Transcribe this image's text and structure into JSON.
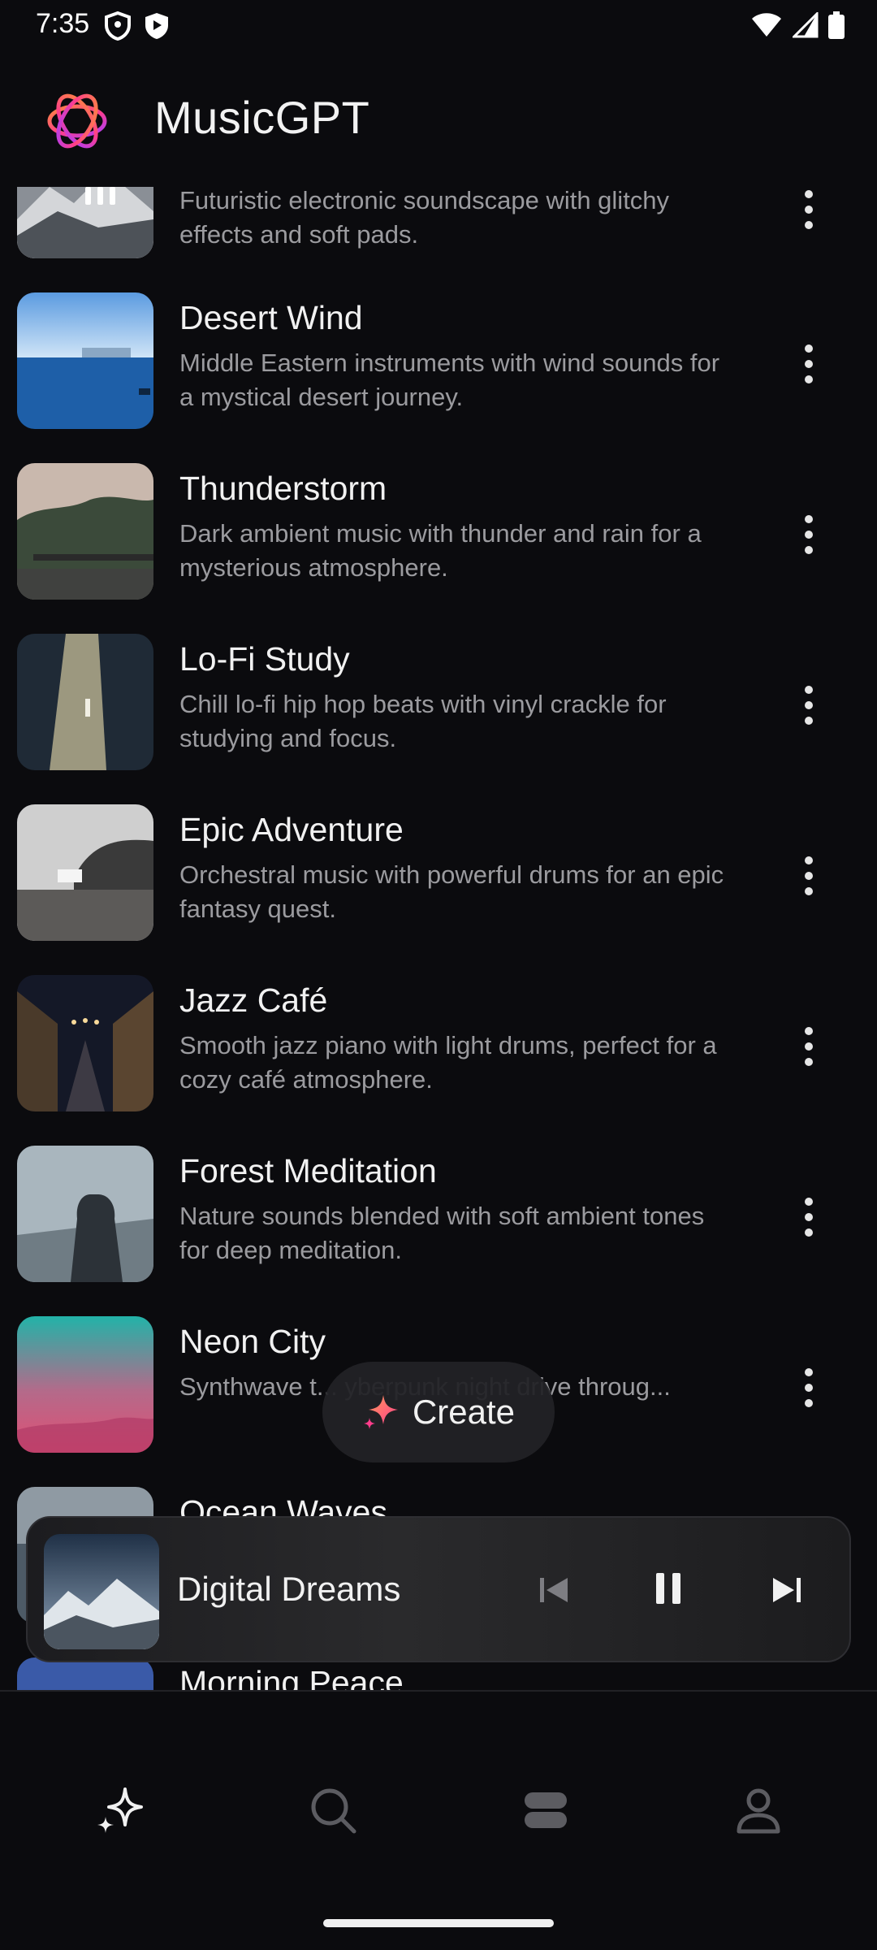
{
  "status_bar": {
    "time": "7:35",
    "left_icons": [
      "shield-icon",
      "play-protect-icon"
    ],
    "right_icons": [
      "wifi-icon",
      "signal-icon",
      "battery-icon"
    ]
  },
  "header": {
    "title": "MusicGPT",
    "logo_colors": [
      "#ff8a3d",
      "#ff3d8b",
      "#a83dff"
    ]
  },
  "tracks": [
    {
      "title": "",
      "description": "Futuristic electronic soundscape with glitchy effects and soft pads.",
      "playing": true
    },
    {
      "title": "Desert Wind",
      "description": "Middle Eastern instruments with wind sounds for a mystical desert journey."
    },
    {
      "title": "Thunderstorm",
      "description": "Dark ambient music with thunder and rain for a mysterious atmosphere."
    },
    {
      "title": "Lo-Fi Study",
      "description": "Chill lo-fi hip hop beats with vinyl crackle for studying and focus."
    },
    {
      "title": "Epic Adventure",
      "description": "Orchestral music with powerful drums for an epic fantasy quest."
    },
    {
      "title": "Jazz Café",
      "description": "Smooth jazz piano with light drums, perfect for a cozy café atmosphere."
    },
    {
      "title": "Forest Meditation",
      "description": "Nature sounds blended with soft ambient tones for deep meditation."
    },
    {
      "title": "Neon City",
      "description": "Synthwave t... yberpunk night drive throug..."
    },
    {
      "title": "Ocean Waves",
      "description": ""
    },
    {
      "title": "Morning Peace",
      "description": ""
    }
  ],
  "create_button": {
    "label": "Create",
    "icon": "sparkle-icon"
  },
  "mini_player": {
    "title": "Digital Dreams",
    "controls": [
      "skip-previous-icon",
      "pause-icon",
      "skip-next-icon"
    ]
  },
  "bottom_nav": {
    "items": [
      {
        "name": "create",
        "icon": "sparkle-icon",
        "active": true
      },
      {
        "name": "search",
        "icon": "search-icon",
        "active": false
      },
      {
        "name": "library",
        "icon": "library-icon",
        "active": false
      },
      {
        "name": "profile",
        "icon": "profile-icon",
        "active": false
      }
    ]
  },
  "colors": {
    "background": "#0b0b0e",
    "title_text": "#f1f1f1",
    "description_text": "#9b9b9f",
    "accent_pink": "#ff4fa0"
  }
}
